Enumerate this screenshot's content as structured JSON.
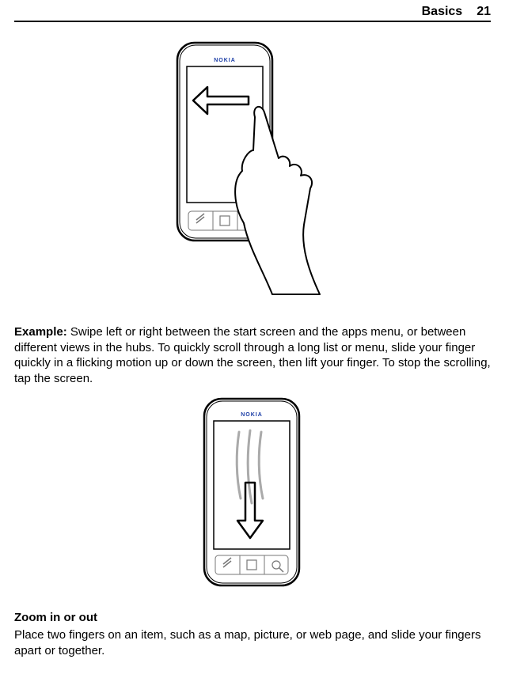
{
  "header": {
    "chapter": "Basics",
    "page_number": "21"
  },
  "illustration1": {
    "brand": "NOKIA",
    "alt": "phone-swipe-left-gesture"
  },
  "example": {
    "label": "Example:",
    "text": "Swipe left or right between the start screen and the apps menu, or between different views in the hubs. To quickly scroll through a long list or menu, slide your finger quickly in a flicking motion up or down the screen, then lift your finger. To stop the scrolling, tap the screen."
  },
  "illustration2": {
    "brand": "NOKIA",
    "alt": "phone-flick-down-gesture"
  },
  "zoom": {
    "heading": "Zoom in or out",
    "text": "Place two fingers on an item, such as a map, picture, or web page, and slide your fingers apart or together."
  }
}
